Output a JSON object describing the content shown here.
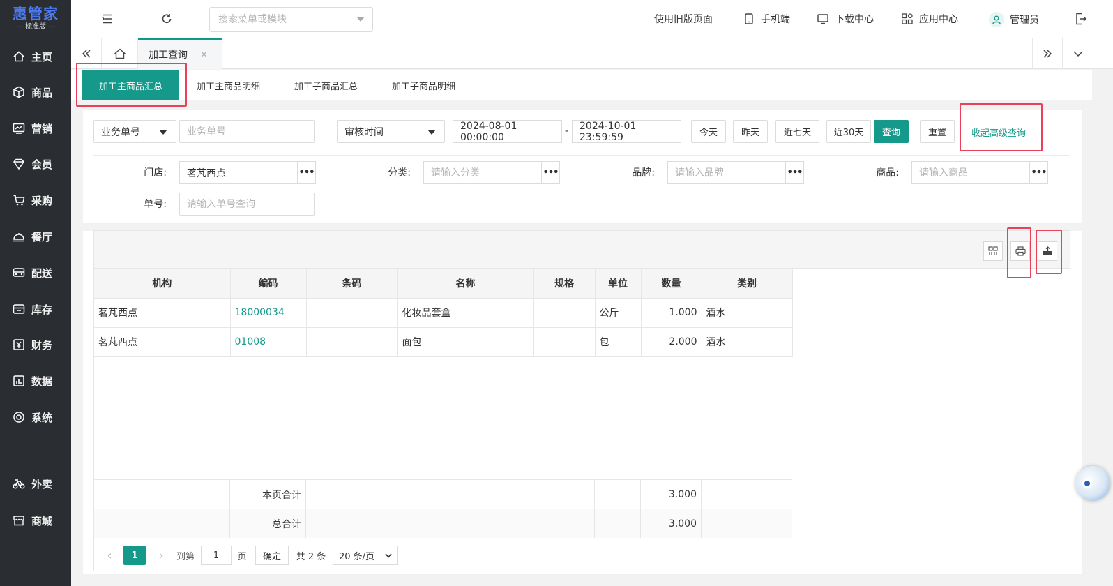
{
  "brand": {
    "name": "惠管家",
    "edition": "— 标准版 —",
    "color": "#4d7bf3"
  },
  "sidebar": {
    "items": [
      {
        "label": "主页",
        "icon": "home-icon"
      },
      {
        "label": "商品",
        "icon": "box-icon"
      },
      {
        "label": "营销",
        "icon": "chart-icon"
      },
      {
        "label": "会员",
        "icon": "diamond-icon"
      },
      {
        "label": "采购",
        "icon": "cart-icon"
      },
      {
        "label": "餐厅",
        "icon": "dish-icon"
      },
      {
        "label": "配送",
        "icon": "truck-icon"
      },
      {
        "label": "库存",
        "icon": "warehouse-icon"
      },
      {
        "label": "财务",
        "icon": "yen-icon"
      },
      {
        "label": "数据",
        "icon": "bar-chart-icon"
      },
      {
        "label": "系统",
        "icon": "settings-icon"
      },
      {
        "label": "外卖",
        "icon": "bike-icon"
      },
      {
        "label": "商城",
        "icon": "store-icon"
      }
    ]
  },
  "topbar": {
    "search_placeholder": "搜索菜单或模块",
    "old_page": "使用旧版页面",
    "mobile": "手机端",
    "download": "下载中心",
    "apps": "应用中心",
    "user": "管理员"
  },
  "tabs": {
    "active_label": "加工查询",
    "close": "×"
  },
  "subtabs": [
    "加工主商品汇总",
    "加工主商品明细",
    "加工子商品汇总",
    "加工子商品明细"
  ],
  "filters": {
    "doc_type": "业务单号",
    "doc_placeholder": "业务单号",
    "time_type": "审核时间",
    "date_start": "2024-08-01 00:00:00",
    "date_sep": "-",
    "date_end": "2024-10-01 23:59:59",
    "quick": [
      "今天",
      "昨天",
      "近七天",
      "近30天"
    ],
    "query": "查询",
    "reset": "重置",
    "collapse": "收起高级查询",
    "store_label": "门店:",
    "store_value": "茗芃西点",
    "category_label": "分类:",
    "category_placeholder": "请输入分类",
    "brand_label": "品牌:",
    "brand_placeholder": "请输入品牌",
    "product_label": "商品:",
    "product_placeholder": "请输入商品",
    "order_label": "单号:",
    "order_placeholder": "请输入单号查询",
    "dots": "•••"
  },
  "table": {
    "columns": [
      "机构",
      "编码",
      "条码",
      "名称",
      "规格",
      "单位",
      "数量",
      "类别"
    ],
    "rows": [
      {
        "org": "茗芃西点",
        "code": "18000034",
        "barcode": "",
        "name": "化妆品套盒",
        "spec": "",
        "unit": "公斤",
        "qty": "1.000",
        "category": "酒水"
      },
      {
        "org": "茗芃西点",
        "code": "01008",
        "barcode": "",
        "name": "面包",
        "spec": "",
        "unit": "包",
        "qty": "2.000",
        "category": "酒水"
      }
    ],
    "page_total_label": "本页合计",
    "page_total_qty": "3.000",
    "grand_total_label": "总合计",
    "grand_total_qty": "3.000"
  },
  "pager": {
    "prev": "‹",
    "current": "1",
    "next": "›",
    "goto": "到第",
    "goto_value": "1",
    "page_unit": "页",
    "confirm": "确定",
    "total": "共 2 条",
    "page_size": "20 条/页"
  },
  "colors": {
    "accent": "#15998a",
    "sidebar": "#2a2e33",
    "highlight": "#e8425a"
  }
}
